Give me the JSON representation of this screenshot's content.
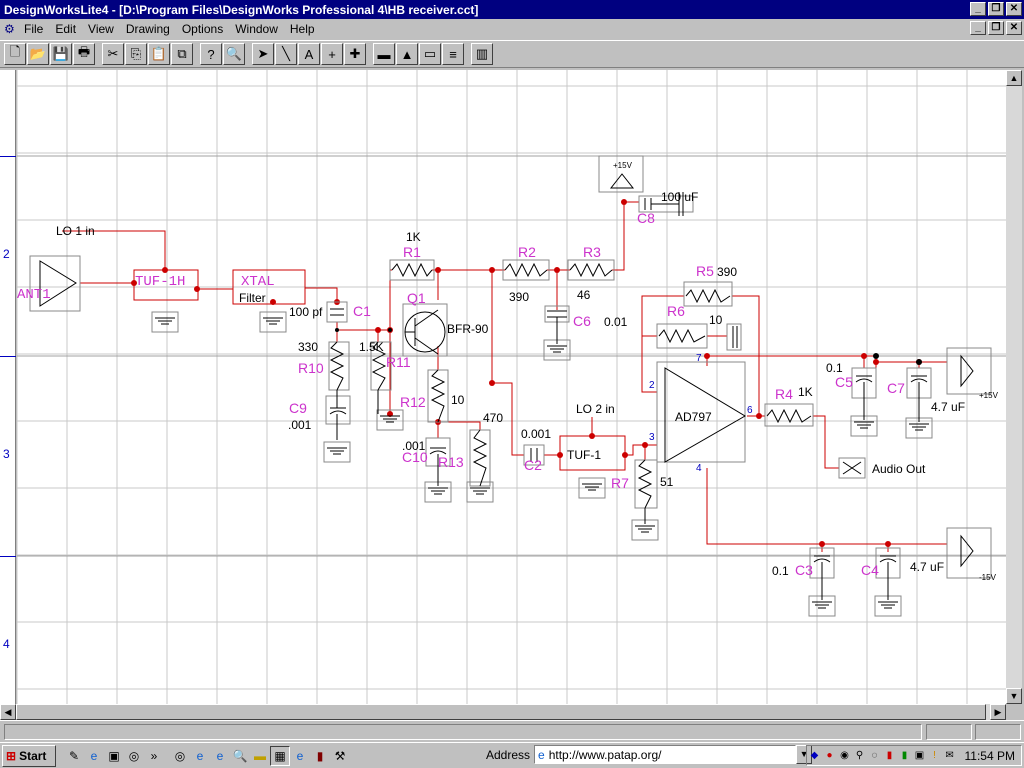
{
  "window": {
    "title": "DesignWorksLite4 - [D:\\Program Files\\DesignWorks Professional 4\\HB receiver.cct]",
    "caption_buttons": [
      "_",
      "❐",
      "✕"
    ]
  },
  "menu": [
    "File",
    "Edit",
    "View",
    "Drawing",
    "Options",
    "Window",
    "Help"
  ],
  "toolbar": {
    "buttons": [
      {
        "name": "new-icon",
        "glyph": "🗋"
      },
      {
        "name": "open-icon",
        "glyph": "📂"
      },
      {
        "name": "save-icon",
        "glyph": "💾"
      },
      {
        "name": "print-icon",
        "glyph": "🖶"
      },
      {
        "name": "cut-icon",
        "glyph": "✂"
      },
      {
        "name": "copy-icon",
        "glyph": "⎘"
      },
      {
        "name": "paste-icon",
        "glyph": "📋"
      },
      {
        "name": "duplicate-icon",
        "glyph": "⧉"
      },
      {
        "name": "help-icon",
        "glyph": "?"
      },
      {
        "name": "zoom-icon",
        "glyph": "🔍"
      },
      {
        "name": "pointer-icon",
        "glyph": "➤"
      },
      {
        "name": "wire-icon",
        "glyph": "╲"
      },
      {
        "name": "text-icon",
        "glyph": "A"
      },
      {
        "name": "crosshair-icon",
        "glyph": "+"
      },
      {
        "name": "add-icon",
        "glyph": "✚"
      },
      {
        "name": "part-window-icon",
        "glyph": "▬"
      },
      {
        "name": "mountain-icon",
        "glyph": "▲"
      },
      {
        "name": "picture-icon",
        "glyph": "▭"
      },
      {
        "name": "signal-icon",
        "glyph": "≡"
      },
      {
        "name": "library-icon",
        "glyph": "▥"
      }
    ]
  },
  "ruler": {
    "marks": [
      "2",
      "3",
      "4"
    ]
  },
  "schematic": {
    "colors": {
      "wire": "#cc0000",
      "part": "#cc0000",
      "label": "#cc33cc",
      "text": "#000000",
      "grid": "#c8c8c8",
      "gridmajor": "#6060e0"
    },
    "labels": {
      "lo1": "LO 1 in",
      "ant1": "ANT1",
      "tuf1h": "TUF-1H",
      "xtal": "XTAL",
      "filter": "Filter",
      "c1": "C1",
      "c1v": "100 pf",
      "r1": "R1",
      "r1v": "1K",
      "r2": "R2",
      "r2v": "390",
      "r3": "R3",
      "r3v": "46",
      "c8": "C8",
      "c8v": "100 uF",
      "v15a": "+15V",
      "q1": "Q1",
      "q1v": "BFR-90",
      "r10": "R10",
      "r10v": "330",
      "r11": "R11",
      "r11v": "1.5K",
      "r12": "R12",
      "r12v": "10",
      "c9": "C9",
      "c9v": ".001",
      "c10": "C10",
      "c10v": ".001",
      "r13": "R13",
      "r13v": "470",
      "c6": "C6",
      "c6v": "0.01",
      "c2": "C2",
      "c2v": "0.001",
      "lo2": "LO 2 in",
      "tuf1": "TUF-1",
      "r7": "R7",
      "r7v": "51",
      "r5": "R5",
      "r5v": "390",
      "r6": "R6",
      "r6v": "10",
      "ad797": "AD797",
      "pin2": "2",
      "pin3": "3",
      "pin6": "6",
      "pin7": "7",
      "pin4": "4",
      "r4": "R4",
      "r4v": "1K",
      "c5": "C5",
      "c5v": "0.1",
      "c7": "C7",
      "c7v": "4.7 uF",
      "v15b": "+15V",
      "audio": "Audio Out",
      "c3": "C3",
      "c3v": "0.1",
      "c4": "C4",
      "c4v": "4.7 uF",
      "vm15": "-15V"
    }
  },
  "taskbar": {
    "start": "Start",
    "address_label": "Address",
    "url": "http://www.patap.org/",
    "clock": "11:54 PM"
  }
}
